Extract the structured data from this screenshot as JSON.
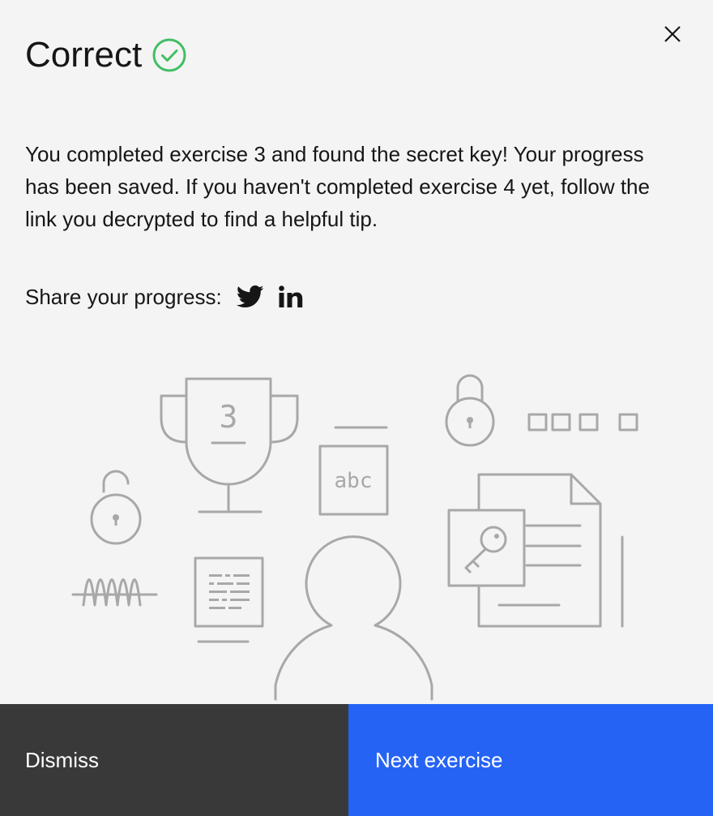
{
  "modal": {
    "title": "Correct",
    "body": "You completed exercise 3 and found the secret key! Your progress has been saved. If you haven't completed exercise 4 yet, follow the link you decrypted to find a helpful tip.",
    "share_label": "Share your progress:",
    "icons": [
      "close-icon",
      "checkmark-circle-icon",
      "twitter-icon",
      "linkedin-icon"
    ],
    "illustration": {
      "trophy_number": "3",
      "card_text": "abc"
    },
    "dismiss_label": "Dismiss",
    "next_label": "Next exercise"
  },
  "colors": {
    "background": "#f4f4f4",
    "success": "#42be65",
    "primary": "#2563f5",
    "secondary": "#393939",
    "illustration_stroke": "#a8a8a8"
  }
}
